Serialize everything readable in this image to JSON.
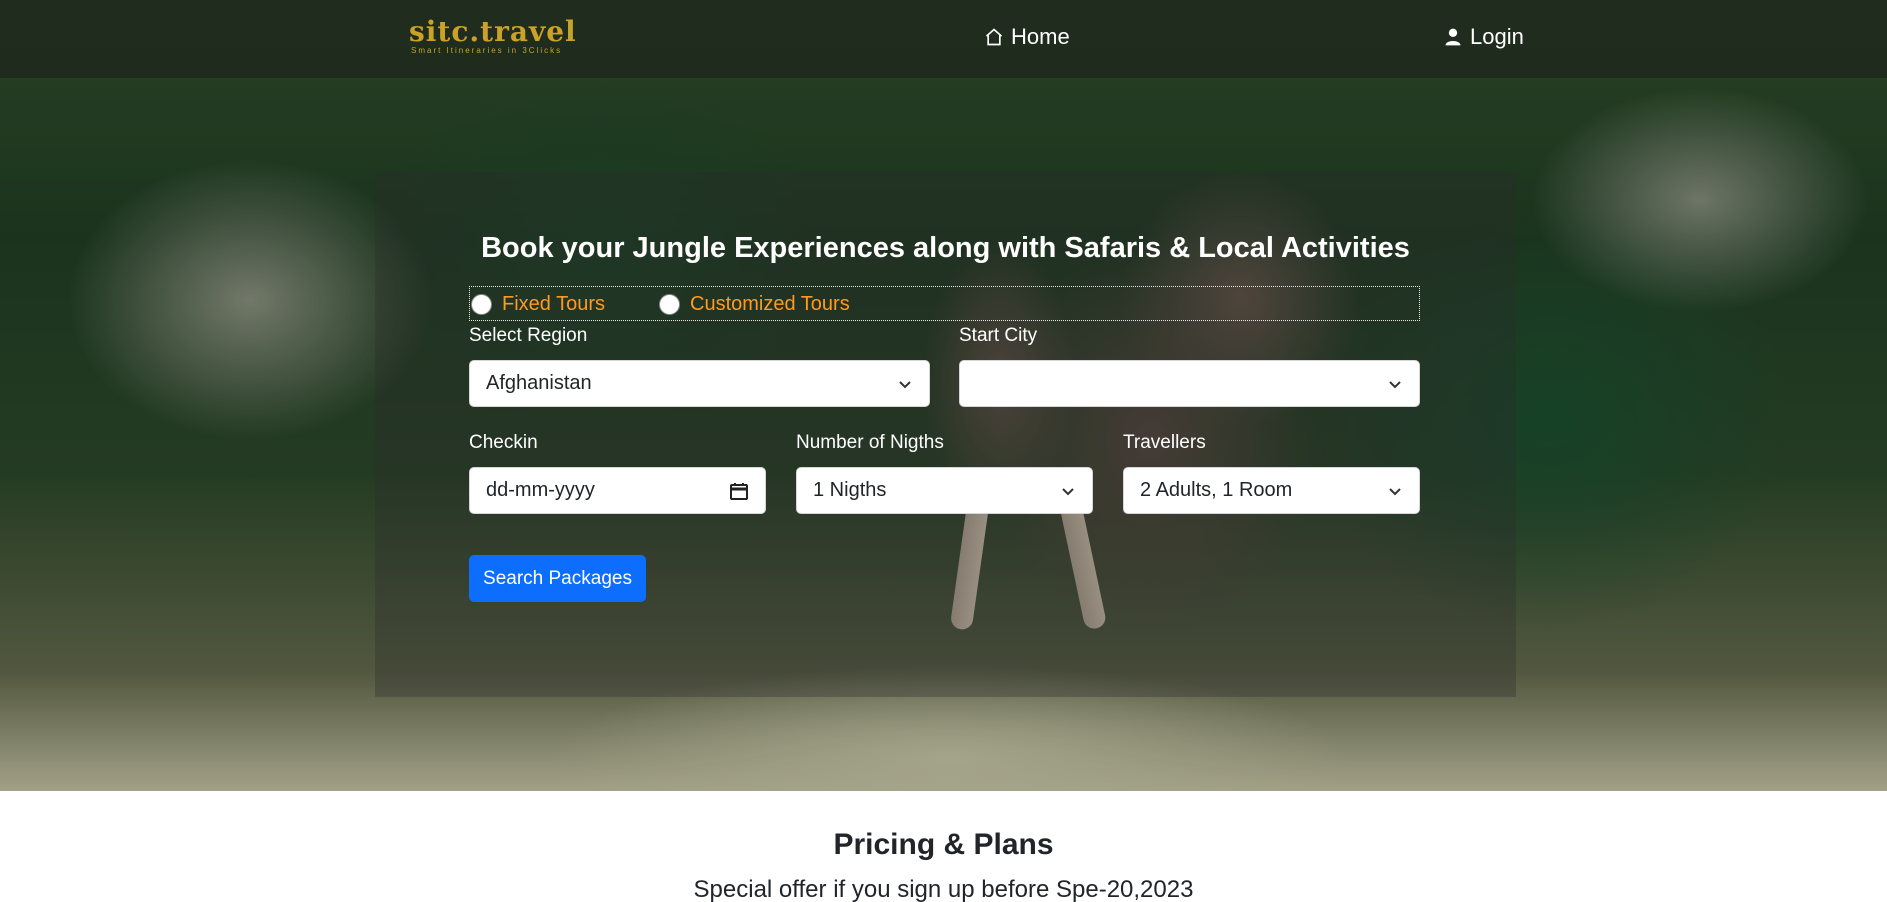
{
  "brand": {
    "logo_text": "sitc.travel",
    "tagline": "Smart Itineraries in 3Clicks",
    "logo_color": "#c9a227"
  },
  "nav": {
    "home_label": "Home",
    "home_icon": "home-icon",
    "login_label": "Login",
    "login_icon": "user-icon"
  },
  "search": {
    "title": "Book your Jungle Experiences along with Safaris & Local Activities",
    "tour_types": [
      {
        "label": "Fixed Tours",
        "checked": false
      },
      {
        "label": "Customized Tours",
        "checked": false
      }
    ],
    "region_label": "Select Region",
    "region_value": "Afghanistan",
    "start_city_label": "Start City",
    "start_city_value": "",
    "checkin_label": "Checkin",
    "checkin_placeholder": "dd-mm-yyyy",
    "nights_label": "Number of Nigths",
    "nights_value": "1 Nigths",
    "travellers_label": "Travellers",
    "travellers_value": "2 Adults, 1 Room",
    "submit_label": "Search Packages",
    "accent_color": "#0d6efd",
    "radio_label_color": "#ff9a1f"
  },
  "pricing": {
    "title": "Pricing & Plans",
    "subtitle": "Special offer if you sign up before Spe-20,2023"
  }
}
